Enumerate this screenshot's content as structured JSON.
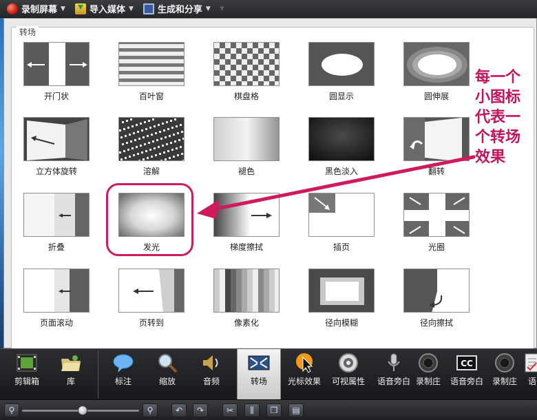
{
  "toolbar": {
    "record_label": "录制屏幕",
    "import_label": "导入媒体",
    "share_label": "生成和分享"
  },
  "transitions": {
    "group_title": "转场",
    "items": [
      {
        "label": "开门状",
        "icon": "open-door-icon"
      },
      {
        "label": "百叶窗",
        "icon": "blinds-icon"
      },
      {
        "label": "棋盘格",
        "icon": "checkerboard-icon"
      },
      {
        "label": "圆显示",
        "icon": "circle-reveal-icon"
      },
      {
        "label": "圆伸展",
        "icon": "circle-stretch-icon"
      },
      {
        "label": "立方体旋转",
        "icon": "cube-rotate-icon"
      },
      {
        "label": "溶解",
        "icon": "dissolve-icon"
      },
      {
        "label": "褪色",
        "icon": "fade-icon"
      },
      {
        "label": "黑色淡入",
        "icon": "fade-black-icon"
      },
      {
        "label": "翻转",
        "icon": "flip-icon"
      },
      {
        "label": "折叠",
        "icon": "fold-icon"
      },
      {
        "label": "发光",
        "icon": "glow-icon"
      },
      {
        "label": "梯度擦拭",
        "icon": "gradient-wipe-icon"
      },
      {
        "label": "插页",
        "icon": "inset-icon"
      },
      {
        "label": "光圈",
        "icon": "iris-icon"
      },
      {
        "label": "页面滚动",
        "icon": "page-roll-icon"
      },
      {
        "label": "页转到",
        "icon": "page-turn-icon"
      },
      {
        "label": "像素化",
        "icon": "pixelate-icon"
      },
      {
        "label": "径向模糊",
        "icon": "radial-blur-icon"
      },
      {
        "label": "径向擦拭",
        "icon": "radial-wipe-icon"
      }
    ]
  },
  "annotation": {
    "lines": [
      "每一个",
      "小图标",
      "代表一",
      "个转场",
      "效果"
    ],
    "color": "#c0155d"
  },
  "tabs": [
    {
      "label": "剪辑箱",
      "icon": "film-clip-icon"
    },
    {
      "label": "库",
      "icon": "library-folder-icon"
    },
    {
      "label": "标注",
      "icon": "callout-bubble-icon"
    },
    {
      "label": "缩放",
      "icon": "zoom-magnifier-icon"
    },
    {
      "label": "音频",
      "icon": "audio-speaker-icon"
    },
    {
      "label": "转场",
      "icon": "transitions-icon"
    },
    {
      "label": "光标效果",
      "icon": "cursor-effect-icon"
    },
    {
      "label": "可视属性",
      "icon": "visual-properties-icon"
    },
    {
      "label": "语音旁白",
      "icon": "microphone-icon"
    },
    {
      "label": "录制庄",
      "icon": "record-camera-icon"
    },
    {
      "label": "语音旁白",
      "icon": "caption-cc-icon"
    },
    {
      "label": "录制庄",
      "icon": "record-camera-icon"
    },
    {
      "label": "语",
      "icon": "quiz-icon"
    }
  ],
  "active_tab": "转场"
}
